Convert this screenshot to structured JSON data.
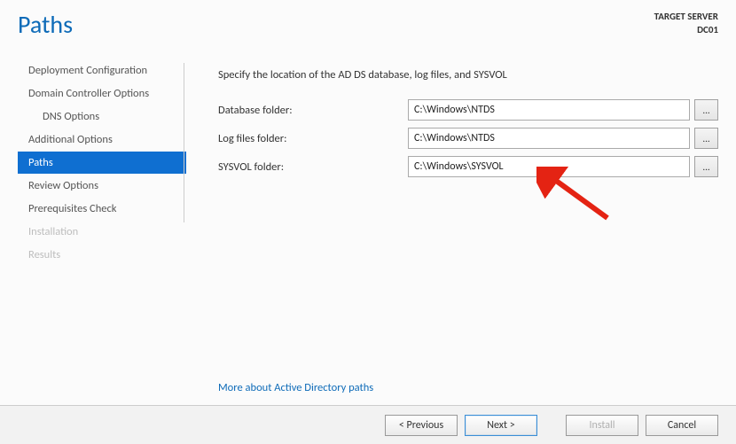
{
  "header": {
    "title": "Paths",
    "target_label": "TARGET SERVER",
    "target_name": "DC01"
  },
  "sidebar": {
    "items": [
      {
        "label": "Deployment Configuration",
        "indent": false,
        "active": false,
        "disabled": false
      },
      {
        "label": "Domain Controller Options",
        "indent": false,
        "active": false,
        "disabled": false
      },
      {
        "label": "DNS Options",
        "indent": true,
        "active": false,
        "disabled": false
      },
      {
        "label": "Additional Options",
        "indent": false,
        "active": false,
        "disabled": false
      },
      {
        "label": "Paths",
        "indent": false,
        "active": true,
        "disabled": false
      },
      {
        "label": "Review Options",
        "indent": false,
        "active": false,
        "disabled": false
      },
      {
        "label": "Prerequisites Check",
        "indent": false,
        "active": false,
        "disabled": false
      },
      {
        "label": "Installation",
        "indent": false,
        "active": false,
        "disabled": true
      },
      {
        "label": "Results",
        "indent": false,
        "active": false,
        "disabled": true
      }
    ]
  },
  "content": {
    "description": "Specify the location of the AD DS database, log files, and SYSVOL",
    "fields": [
      {
        "label": "Database folder:",
        "value": "C:\\Windows\\NTDS",
        "name": "database-folder"
      },
      {
        "label": "Log files folder:",
        "value": "C:\\Windows\\NTDS",
        "name": "logfiles-folder"
      },
      {
        "label": "SYSVOL folder:",
        "value": "C:\\Windows\\SYSVOL",
        "name": "sysvol-folder"
      }
    ],
    "browse_label": "...",
    "more_link": "More about Active Directory paths"
  },
  "buttons": {
    "previous": "< Previous",
    "next": "Next >",
    "install": "Install",
    "cancel": "Cancel"
  }
}
